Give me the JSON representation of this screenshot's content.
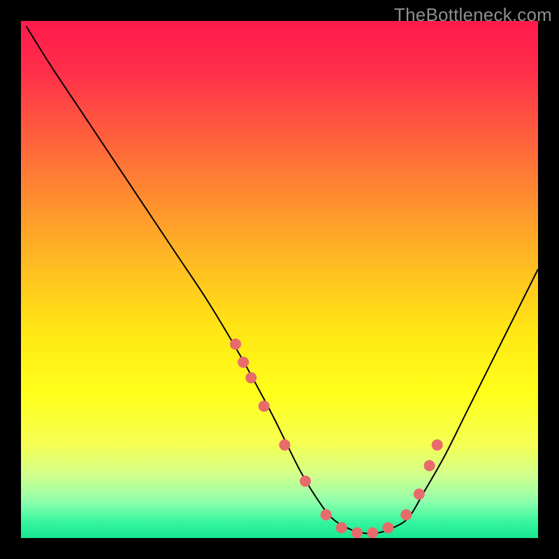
{
  "watermark": "TheBottleneck.com",
  "chart_data": {
    "type": "line",
    "title": "",
    "xlabel": "",
    "ylabel": "",
    "xlim": [
      0,
      100
    ],
    "ylim": [
      0,
      100
    ],
    "grid": false,
    "legend": false,
    "background_gradient_stops": [
      {
        "offset": 0.0,
        "color": "#ff1a4d"
      },
      {
        "offset": 0.1,
        "color": "#ff2f4a"
      },
      {
        "offset": 0.25,
        "color": "#ff6a3a"
      },
      {
        "offset": 0.45,
        "color": "#ffb524"
      },
      {
        "offset": 0.6,
        "color": "#ffe714"
      },
      {
        "offset": 0.72,
        "color": "#ffff1a"
      },
      {
        "offset": 0.82,
        "color": "#f5ff54"
      },
      {
        "offset": 0.88,
        "color": "#d0ff8e"
      },
      {
        "offset": 0.93,
        "color": "#8effad"
      },
      {
        "offset": 0.97,
        "color": "#35f59e"
      },
      {
        "offset": 1.0,
        "color": "#17e890"
      }
    ],
    "series": [
      {
        "name": "bottleneck-curve",
        "color": "#000000",
        "stroke_width": 2,
        "x": [
          1,
          6,
          12,
          18,
          24,
          30,
          36,
          42,
          48,
          51,
          54,
          57,
          60,
          63,
          66,
          69,
          72,
          75,
          78,
          82,
          86,
          90,
          94,
          98,
          100
        ],
        "y": [
          99,
          91,
          82,
          73,
          64,
          55,
          46,
          36,
          25,
          19,
          13,
          8,
          4,
          2,
          1,
          1,
          2,
          4,
          9,
          16,
          24,
          32,
          40,
          48,
          52
        ]
      }
    ],
    "markers": {
      "name": "highlight-points",
      "color": "#e76b6b",
      "radius": 8,
      "x": [
        41.5,
        43,
        44.5,
        47,
        51,
        55,
        59,
        62,
        65,
        68,
        71,
        74.5,
        77,
        79,
        80.5
      ],
      "y": [
        37.5,
        34,
        31,
        25.5,
        18,
        11,
        4.5,
        2,
        1,
        1,
        2,
        4.5,
        8.5,
        14,
        18
      ]
    }
  }
}
